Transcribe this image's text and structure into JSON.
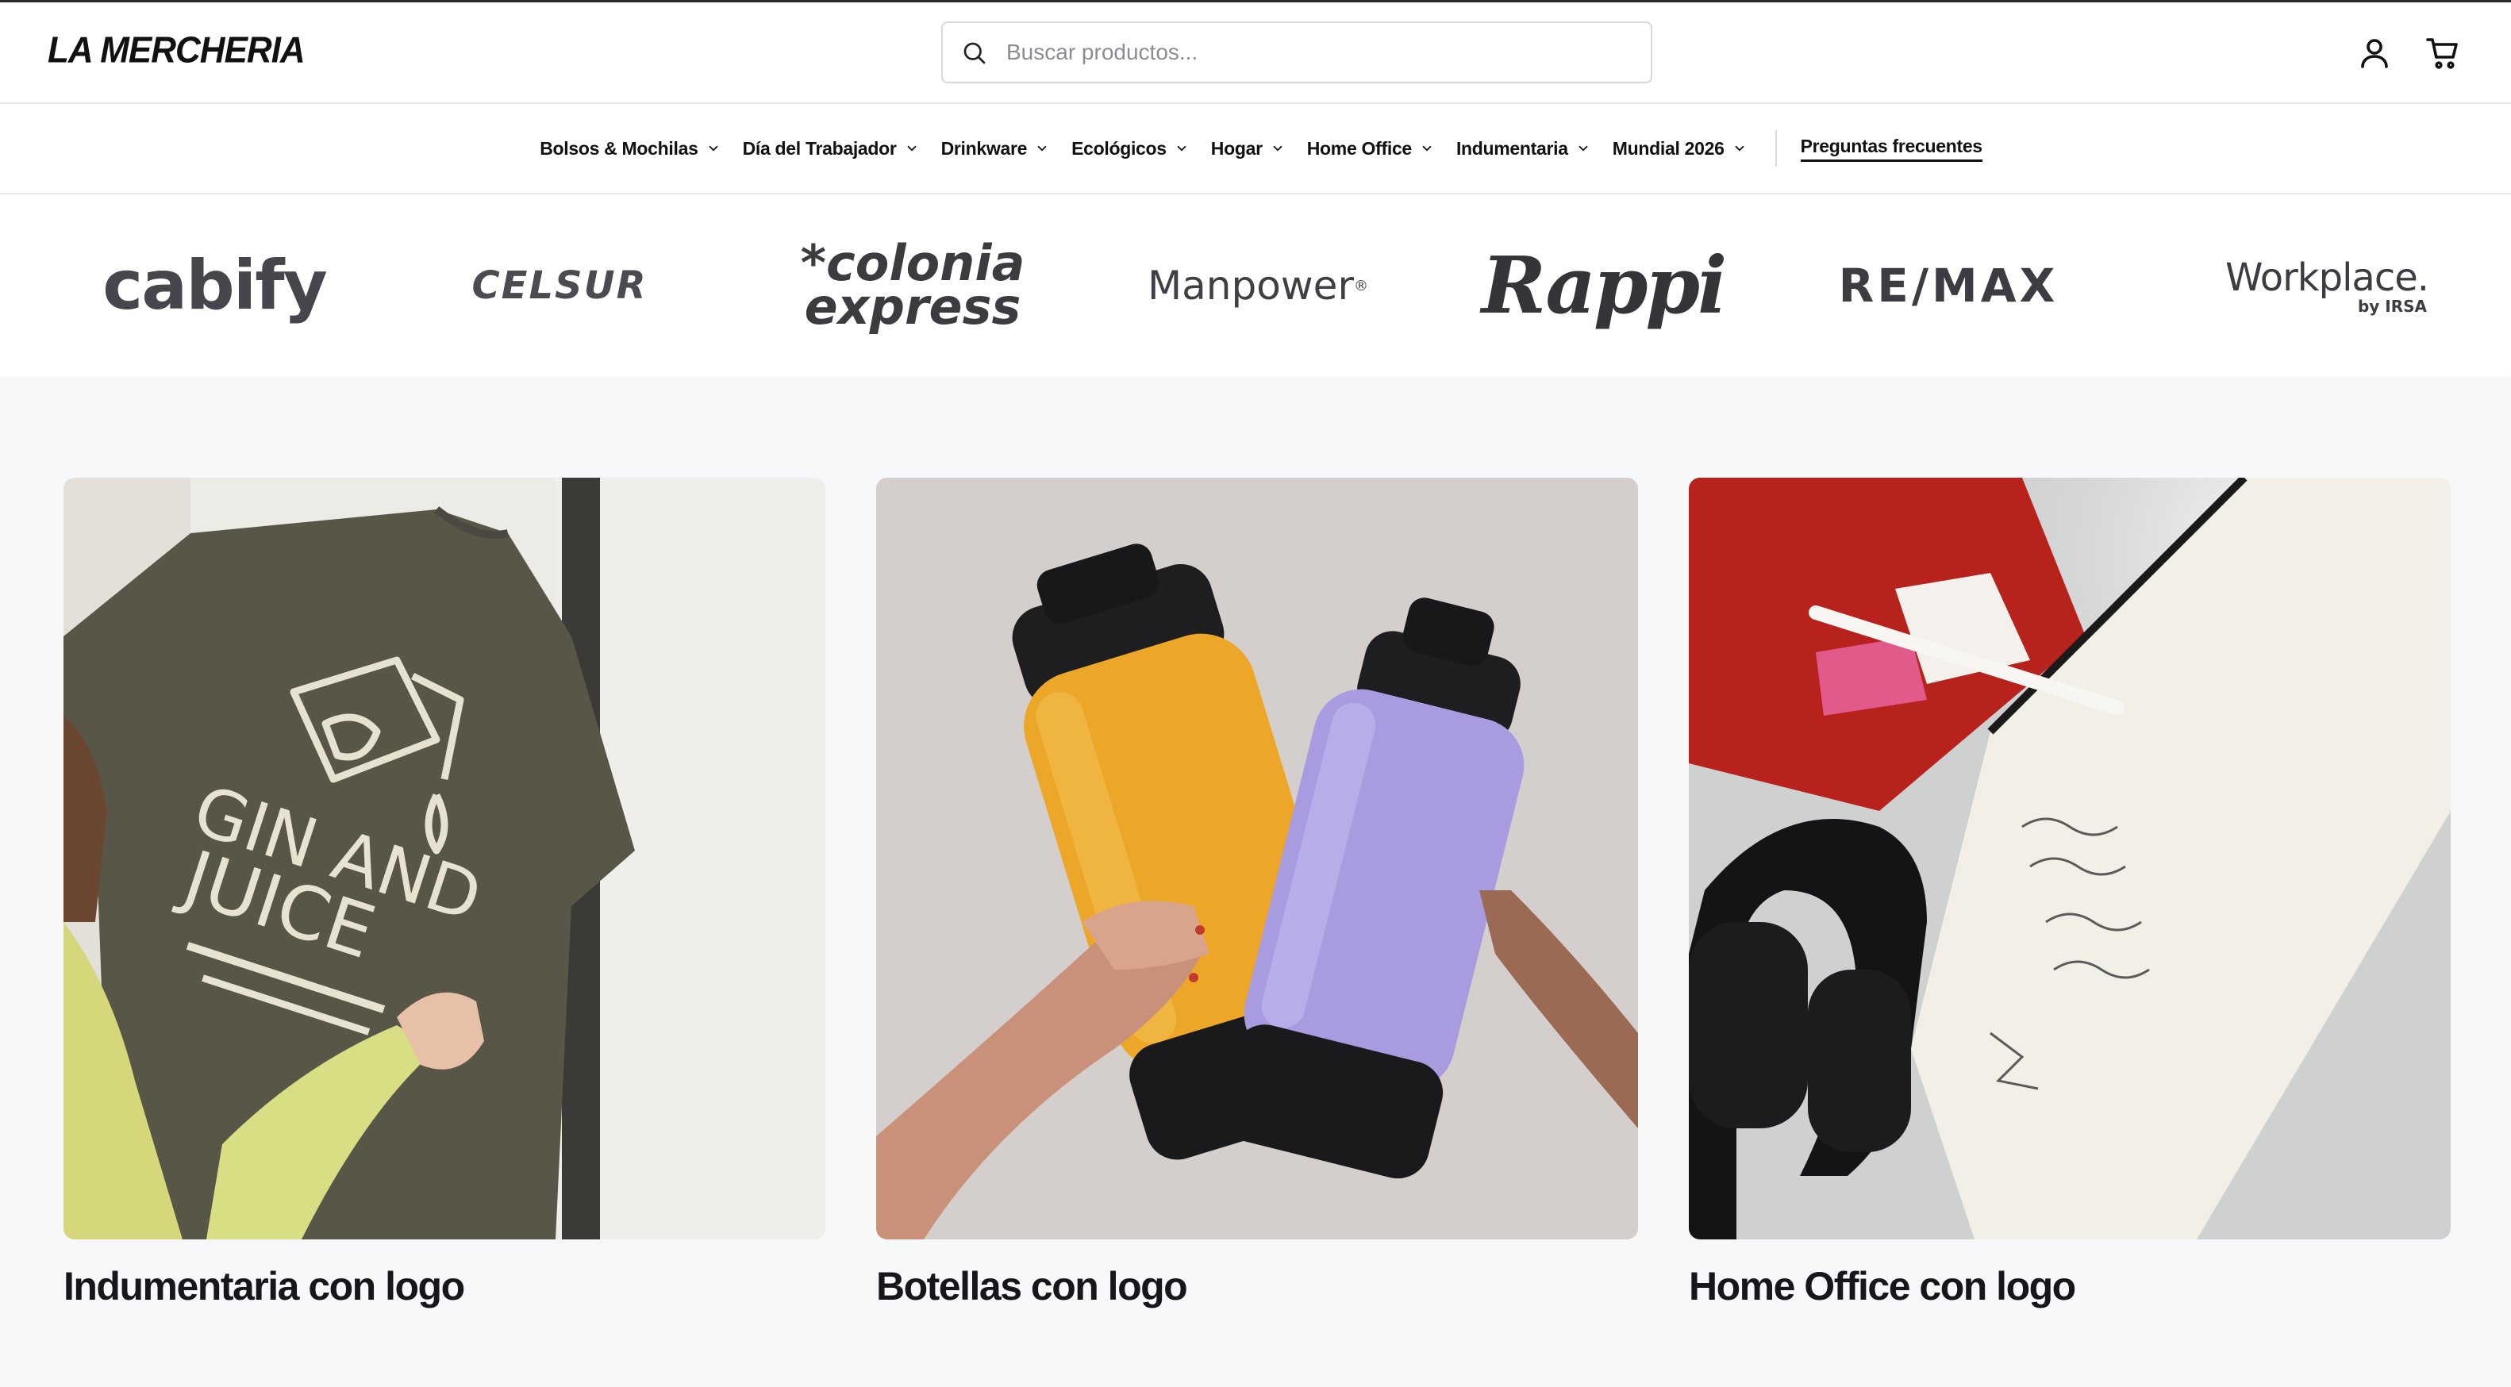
{
  "header": {
    "logo": "LA MERCHERIA",
    "search_placeholder": "Buscar productos..."
  },
  "nav": {
    "items": [
      {
        "label": "Bolsos & Mochilas"
      },
      {
        "label": "Día del Trabajador"
      },
      {
        "label": "Drinkware"
      },
      {
        "label": "Ecológicos"
      },
      {
        "label": "Hogar"
      },
      {
        "label": "Home Office"
      },
      {
        "label": "Indumentaria"
      },
      {
        "label": "Mundial 2026"
      }
    ],
    "faq_label": "Preguntas frecuentes"
  },
  "brands": {
    "cabify": "cabify",
    "celsur": "CELSUR",
    "colonia_line1": "*colonia",
    "colonia_line2": "express",
    "manpower": "Manpower",
    "manpower_mark": "®",
    "rappi": "Rappi",
    "remax": "RE/MAX",
    "workplace": "Workplace.",
    "workplace_sub": "by IRSA"
  },
  "tshirt_print": {
    "line1": "GIN AND",
    "line2": "JUICE"
  },
  "categories": [
    {
      "title": "Indumentaria con logo"
    },
    {
      "title": "Botellas con logo"
    },
    {
      "title": "Home Office con logo"
    }
  ],
  "icons": {
    "search": "search-icon",
    "account": "user-icon",
    "cart": "cart-icon",
    "nav_chevron": "chevron-down-icon"
  },
  "colors": {
    "text": "#111111",
    "page_bg": "#f7f8fa",
    "bottle_yellow": "#eca628",
    "bottle_purple": "#a99be0"
  }
}
